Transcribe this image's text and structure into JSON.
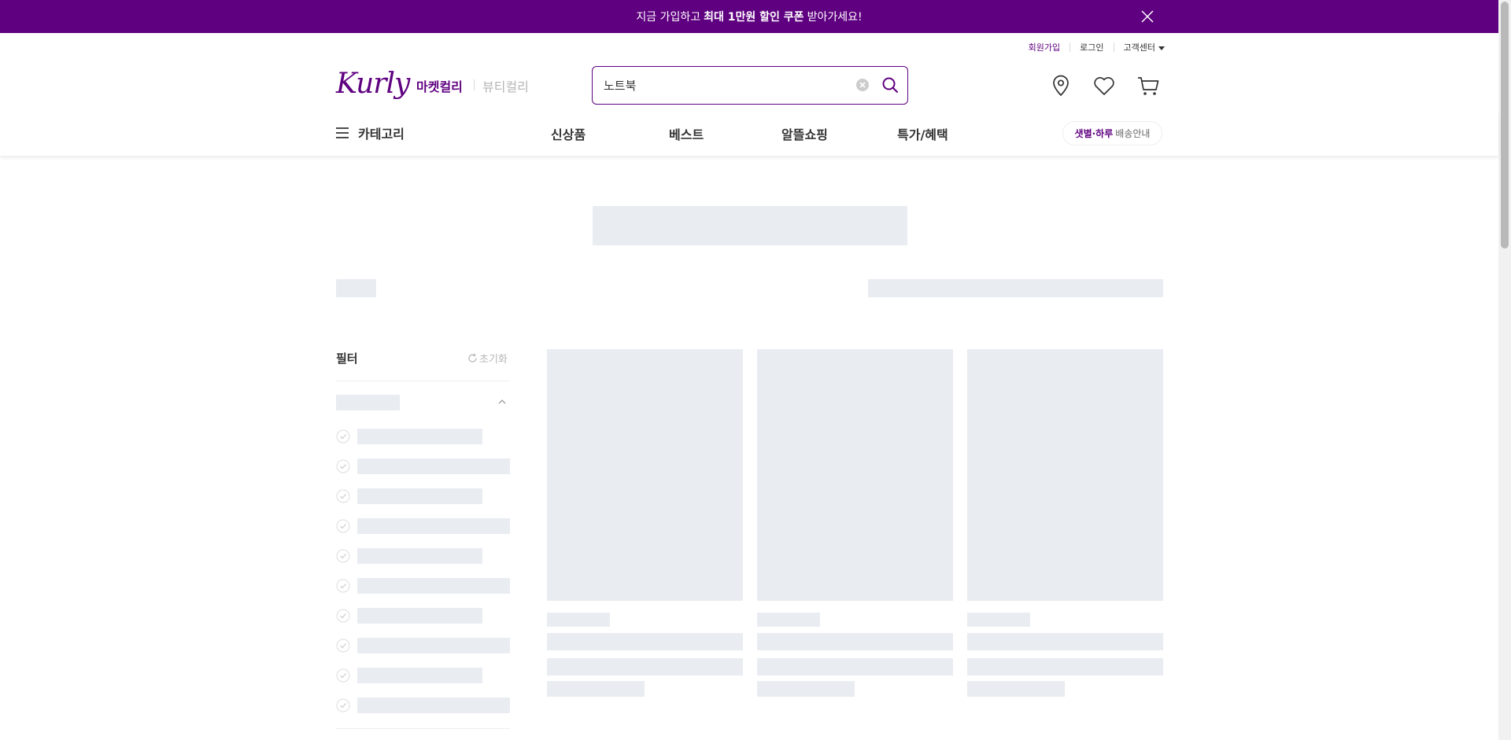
{
  "banner": {
    "prefix": "지금 가입하고",
    "highlight": "최대 1만원 할인 쿠폰",
    "suffix": "받아가세요!"
  },
  "user_links": {
    "signup": "회원가입",
    "login": "로그인",
    "customer_center": "고객센터"
  },
  "brand": {
    "logo": "Kurly",
    "market_tab": "마켓컬리",
    "beauty_tab": "뷰티컬리"
  },
  "search": {
    "value": "노트북"
  },
  "gnb": {
    "category": "카테고리",
    "menu": [
      "신상품",
      "베스트",
      "알뜰쇼핑",
      "특가/혜택"
    ],
    "delivery_highlight": "샛별·하루",
    "delivery_text": "배송안내"
  },
  "filter": {
    "title": "필터",
    "reset": "초기화"
  },
  "colors": {
    "brand": "#5f0080",
    "skeleton": "#e9ecf1"
  },
  "icons": [
    "close-icon",
    "clear-icon",
    "search-icon",
    "location-icon",
    "heart-icon",
    "cart-icon",
    "hamburger-icon",
    "refresh-icon",
    "chevron-up-icon",
    "check-circle-icon"
  ]
}
